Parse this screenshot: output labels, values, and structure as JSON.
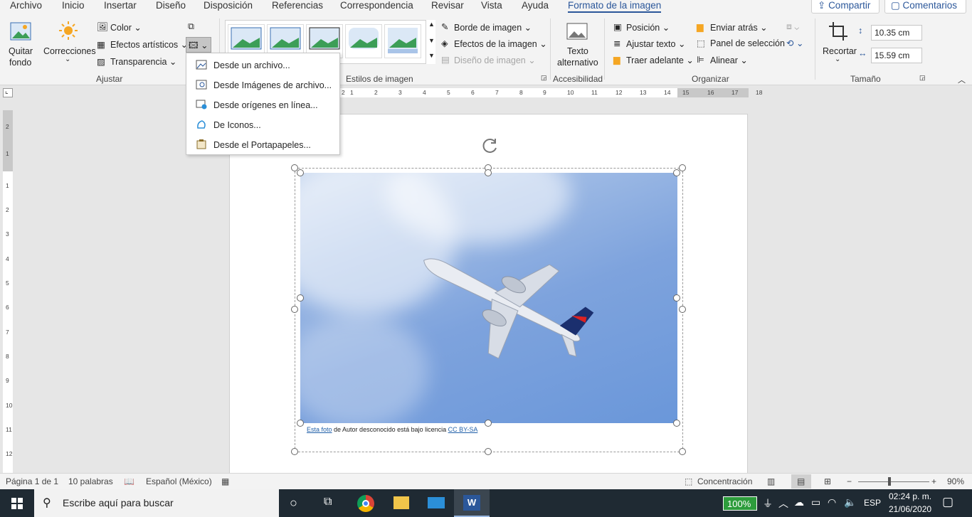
{
  "tabs": [
    "Archivo",
    "Inicio",
    "Insertar",
    "Diseño",
    "Disposición",
    "Referencias",
    "Correspondencia",
    "Revisar",
    "Vista",
    "Ayuda",
    "Formato de la imagen"
  ],
  "top_buttons": {
    "share": "Compartir",
    "comments": "Comentarios"
  },
  "ribbon": {
    "remove_bg": [
      "Quitar",
      "fondo"
    ],
    "corrections": "Correcciones",
    "color": "Color",
    "artistic": "Efectos artísticos",
    "transparency": "Transparencia",
    "group_adjust": "Ajustar",
    "group_styles": "Estilos de imagen",
    "border": "Borde de imagen",
    "effects": "Efectos de la imagen",
    "layout": "Diseño de imagen",
    "alt_text": [
      "Texto",
      "alternativo"
    ],
    "group_access": "Accesibilidad",
    "position": "Posición",
    "wrap": "Ajustar texto",
    "bring_forward": "Traer adelante",
    "send_back": "Enviar atrás",
    "selection_pane": "Panel de selección",
    "align": "Alinear",
    "group_arrange": "Organizar",
    "crop": "Recortar",
    "height": "10.35 cm",
    "width": "15.59 cm",
    "group_size": "Tamaño"
  },
  "menu": [
    {
      "label": "Desde un archivo...",
      "icon": "file-image-icon"
    },
    {
      "label": "Desde Imágenes de archivo...",
      "icon": "stock-images-icon"
    },
    {
      "label": "Desde orígenes en línea...",
      "icon": "online-image-icon"
    },
    {
      "label": "De Iconos...",
      "icon": "icons-icon"
    },
    {
      "label": "Desde el Portapapeles...",
      "icon": "clipboard-icon"
    }
  ],
  "ruler_h": [
    "2",
    "1",
    "2",
    "3",
    "4",
    "5",
    "6",
    "7",
    "8",
    "9",
    "10",
    "11",
    "12",
    "13",
    "14",
    "15",
    "16",
    "17",
    "18"
  ],
  "ruler_v": [
    "2",
    "1",
    "1",
    "2",
    "3",
    "4",
    "5",
    "6",
    "7",
    "8",
    "9",
    "10",
    "11",
    "12"
  ],
  "caption": {
    "link1": "Esta foto",
    "middle": " de Autor desconocido está bajo licencia ",
    "link2": "CC BY-SA"
  },
  "status": {
    "page": "Página 1 de 1",
    "words": "10 palabras",
    "language": "Español (México)",
    "focus": "Concentración",
    "zoom": "90%"
  },
  "taskbar": {
    "search_placeholder": "Escribe aquí para buscar",
    "battery": "100%",
    "lang": "ESP",
    "time": "02:24 p. m.",
    "date": "21/06/2020"
  },
  "colors": {
    "accent": "#2b579a",
    "taskbar": "#1f2a33",
    "sky": "#6a97da",
    "battery": "#2d9c3c"
  }
}
